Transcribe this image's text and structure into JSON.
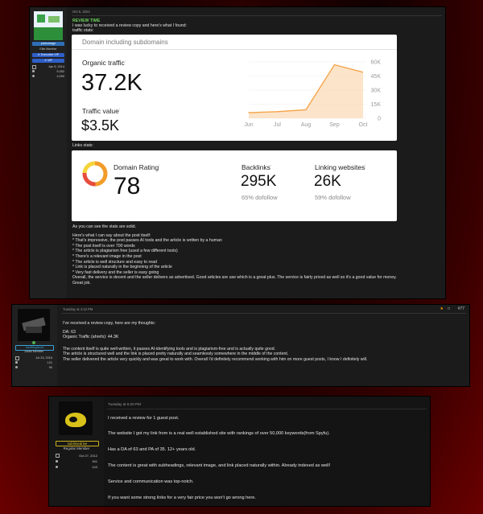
{
  "post1": {
    "user": {
      "name": "pixelcharge",
      "title": "Elite Member",
      "badge1": "✕ Executive VIP",
      "badge2": "✕ VIP",
      "stats": [
        {
          "icon": "calendar-icon",
          "value": "Apr 5, 2014"
        },
        {
          "icon": "messages-icon",
          "value": "5,052"
        },
        {
          "icon": "reactions-icon",
          "value": "4,090"
        }
      ]
    },
    "date": "Oct 6, 2024",
    "heading": "REVIEW TIME",
    "intro": "I was lucky to received a review copy and here's what I found:",
    "traffic_label": "traffic stats:",
    "traffic_card": {
      "header": "Domain including subdomains",
      "organic_label": "Organic traffic",
      "organic_value": "37.2K",
      "traffic_value_label": "Traffic value",
      "traffic_value": "$3.5K"
    },
    "links_label": "Links stats:",
    "links_card": {
      "dr_label": "Domain Rating",
      "dr_value": "78",
      "backlinks_label": "Backlinks",
      "backlinks_value": "295K",
      "backlinks_sub": "65% dofollow",
      "linking_label": "Linking websites",
      "linking_value": "26K",
      "linking_sub": "59% dofollow"
    },
    "body_lines": [
      "As you can see the stats are solid.",
      "",
      "Here's what I can say about the post itself:",
      "* That's impressive, the post passes AI tools and the article is written by a human",
      "* The post itself is over 700 words",
      "* The article is plagiarism free (used a few different tools)",
      "* There's a relevant image in the post",
      "* The article is well structure and easy to read",
      "* Link is placed naturally in the beginning of the article",
      "* Very fast delivery and the seller is easy going",
      "Overall, the service is decent and the seller delivers as advertised. Good articles are use which is a great plus. The service is fairly priced as well so it's a good value for money.",
      "Great job."
    ]
  },
  "chart_data": {
    "type": "area",
    "categories": [
      "Jun",
      "Jul",
      "Aug",
      "Sep",
      "Oct"
    ],
    "values": [
      6000,
      7000,
      9000,
      57000,
      49000
    ],
    "ylim": [
      0,
      60000
    ],
    "yticks": [
      "60K",
      "45K",
      "30K",
      "15K",
      "0"
    ],
    "color": "#f5a44a"
  },
  "post2": {
    "user": {
      "name": "IcedMegabots",
      "title": "Junior Member",
      "stats": [
        {
          "icon": "calendar-icon",
          "value": "Jul 23, 2015"
        },
        {
          "icon": "messages-icon",
          "value": "121"
        },
        {
          "icon": "reactions-icon",
          "value": "90"
        }
      ]
    },
    "date": "Tuesday at 4:12 PM",
    "post_number": "#77",
    "lines": [
      "I've received a review copy, here are my thoughts:",
      "",
      "DA: 63",
      "Organic Traffic (ahrefs): 44.3K",
      "",
      "The content itself is quite well-written, it passes AI-identifying tools and is plagiarism-free and is actually quite good.",
      "The article is structured well and the link is placed pretty naturally and seamlessly somewhere in the middle of the content.",
      "The seller delivered the article very quickly and was great to work with. Overall I'd definitely recommend working with him on more guest posts, I know I definitely will."
    ]
  },
  "post3": {
    "user": {
      "name": "sublimedrive",
      "title": "Regular Member",
      "stats": [
        {
          "icon": "calendar-icon",
          "value": "Oct 27, 2012"
        },
        {
          "icon": "messages-icon",
          "value": "341"
        },
        {
          "icon": "reactions-icon",
          "value": "143"
        }
      ]
    },
    "date": "Tuesday at 5:20 PM",
    "lines": [
      "I received a review for 1 guest post.",
      "The website I got my link from is a real well established site with rankings of over 50,000 keywords(from Spyfu).",
      "Has a DA of 63 and PA of 35. 12+ years old.",
      "The content is great with subheadings, relevant image, and link placed naturally within. Already indexed as well!",
      "Service and communication was top-notch.",
      "If you want some strong links for a very fair price you won't go wrong here."
    ]
  }
}
